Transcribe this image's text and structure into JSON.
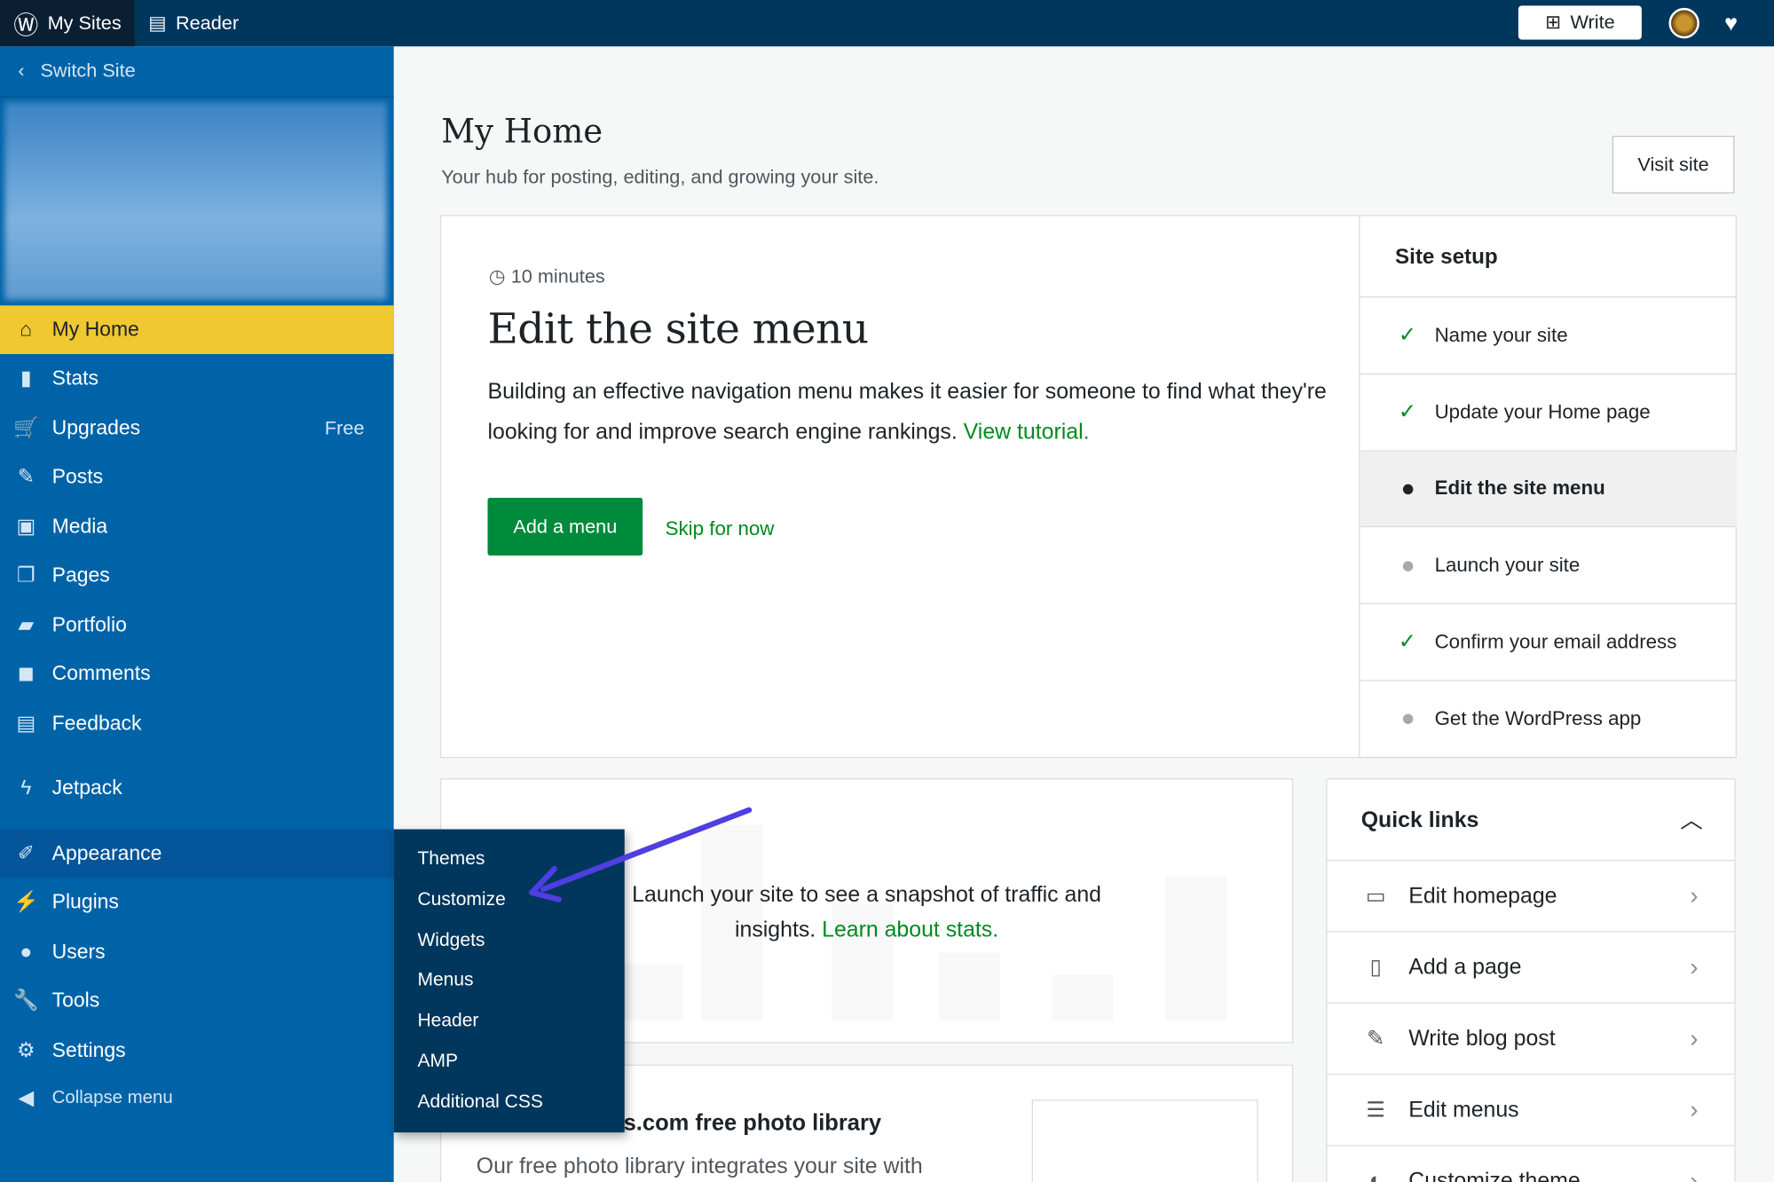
{
  "topbar": {
    "my_sites": "My Sites",
    "reader": "Reader",
    "write": "Write"
  },
  "sidebar": {
    "switch_site": "Switch Site",
    "items": [
      {
        "label": "My Home",
        "icon": "home-icon",
        "active": true
      },
      {
        "label": "Stats",
        "icon": "stats-icon"
      },
      {
        "label": "Upgrades",
        "icon": "cart-icon",
        "badge": "Free"
      },
      {
        "label": "Posts",
        "icon": "pin-icon"
      },
      {
        "label": "Media",
        "icon": "media-icon"
      },
      {
        "label": "Pages",
        "icon": "pages-icon"
      },
      {
        "label": "Portfolio",
        "icon": "folder-icon"
      },
      {
        "label": "Comments",
        "icon": "comment-icon"
      },
      {
        "label": "Feedback",
        "icon": "feedback-icon"
      },
      {
        "label": "Jetpack",
        "icon": "jetpack-icon"
      },
      {
        "label": "Appearance",
        "icon": "brush-icon",
        "hover": true
      },
      {
        "label": "Plugins",
        "icon": "plugin-icon"
      },
      {
        "label": "Users",
        "icon": "user-icon"
      },
      {
        "label": "Tools",
        "icon": "wrench-icon"
      },
      {
        "label": "Settings",
        "icon": "settings-icon"
      }
    ],
    "collapse": "Collapse menu",
    "flyout": [
      "Themes",
      "Customize",
      "Widgets",
      "Menus",
      "Header",
      "AMP",
      "Additional CSS"
    ]
  },
  "main": {
    "title": "My Home",
    "subtitle": "Your hub for posting, editing, and growing your site.",
    "visit_site": "Visit site",
    "task": {
      "time": "10 minutes",
      "title": "Edit the site menu",
      "desc": "Building an effective navigation menu makes it easier for someone to find what they're looking for and improve search engine rankings.",
      "tutorial": "View tutorial.",
      "primary": "Add a menu",
      "skip": "Skip for now"
    },
    "setup": {
      "title": "Site setup",
      "items": [
        {
          "label": "Name your site",
          "state": "done"
        },
        {
          "label": "Update your Home page",
          "state": "done"
        },
        {
          "label": "Edit the site menu",
          "state": "current"
        },
        {
          "label": "Launch your site",
          "state": "todo"
        },
        {
          "label": "Confirm your email address",
          "state": "done"
        },
        {
          "label": "Get the WordPress app",
          "state": "todo"
        }
      ]
    },
    "stats": {
      "text1": "Launch your site to see a snapshot of traffic and",
      "text2": "insights.",
      "link": "Learn about stats."
    },
    "photo": {
      "title": "ss.com free photo library",
      "desc": "Our free photo library integrates your site with"
    },
    "quick_links": {
      "title": "Quick links",
      "items": [
        {
          "label": "Edit homepage",
          "icon": "laptop-icon"
        },
        {
          "label": "Add a page",
          "icon": "page-icon"
        },
        {
          "label": "Write blog post",
          "icon": "pencil-icon"
        },
        {
          "label": "Edit menus",
          "icon": "list-icon"
        },
        {
          "label": "Customize theme",
          "icon": "palette-icon"
        }
      ]
    }
  },
  "colors": {
    "topbar": "#01365d",
    "sidebar": "#0063a8",
    "active": "#f0c830",
    "accent": "#008a20",
    "arrow": "#4f3ee0"
  }
}
